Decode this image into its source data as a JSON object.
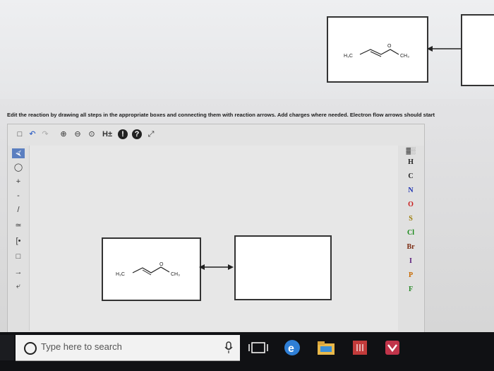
{
  "instruction": "Edit the reaction by drawing all steps in the appropriate boxes and connecting them with reaction arrows. Add charges where needed. Electron flow arrows should start",
  "molecule": {
    "left_label": "H₃C",
    "oxygen_label": "O",
    "right_label": "CH₃"
  },
  "toolbar": {
    "h_label": "H±",
    "info_icon": "!",
    "help_icon": "?"
  },
  "periodic": {
    "elements": [
      "H",
      "C",
      "N",
      "O",
      "S",
      "Cl",
      "Br",
      "I",
      "P",
      "F"
    ],
    "colors": {
      "H": "#222",
      "C": "#222",
      "N": "#1a2fb0",
      "O": "#c81c1c",
      "S": "#9a7a00",
      "Cl": "#1a8a1a",
      "Br": "#7a2a10",
      "I": "#5a1a7a",
      "P": "#c86a00",
      "F": "#2a8a2a"
    }
  },
  "taskbar": {
    "search_placeholder": "Type here to search"
  }
}
